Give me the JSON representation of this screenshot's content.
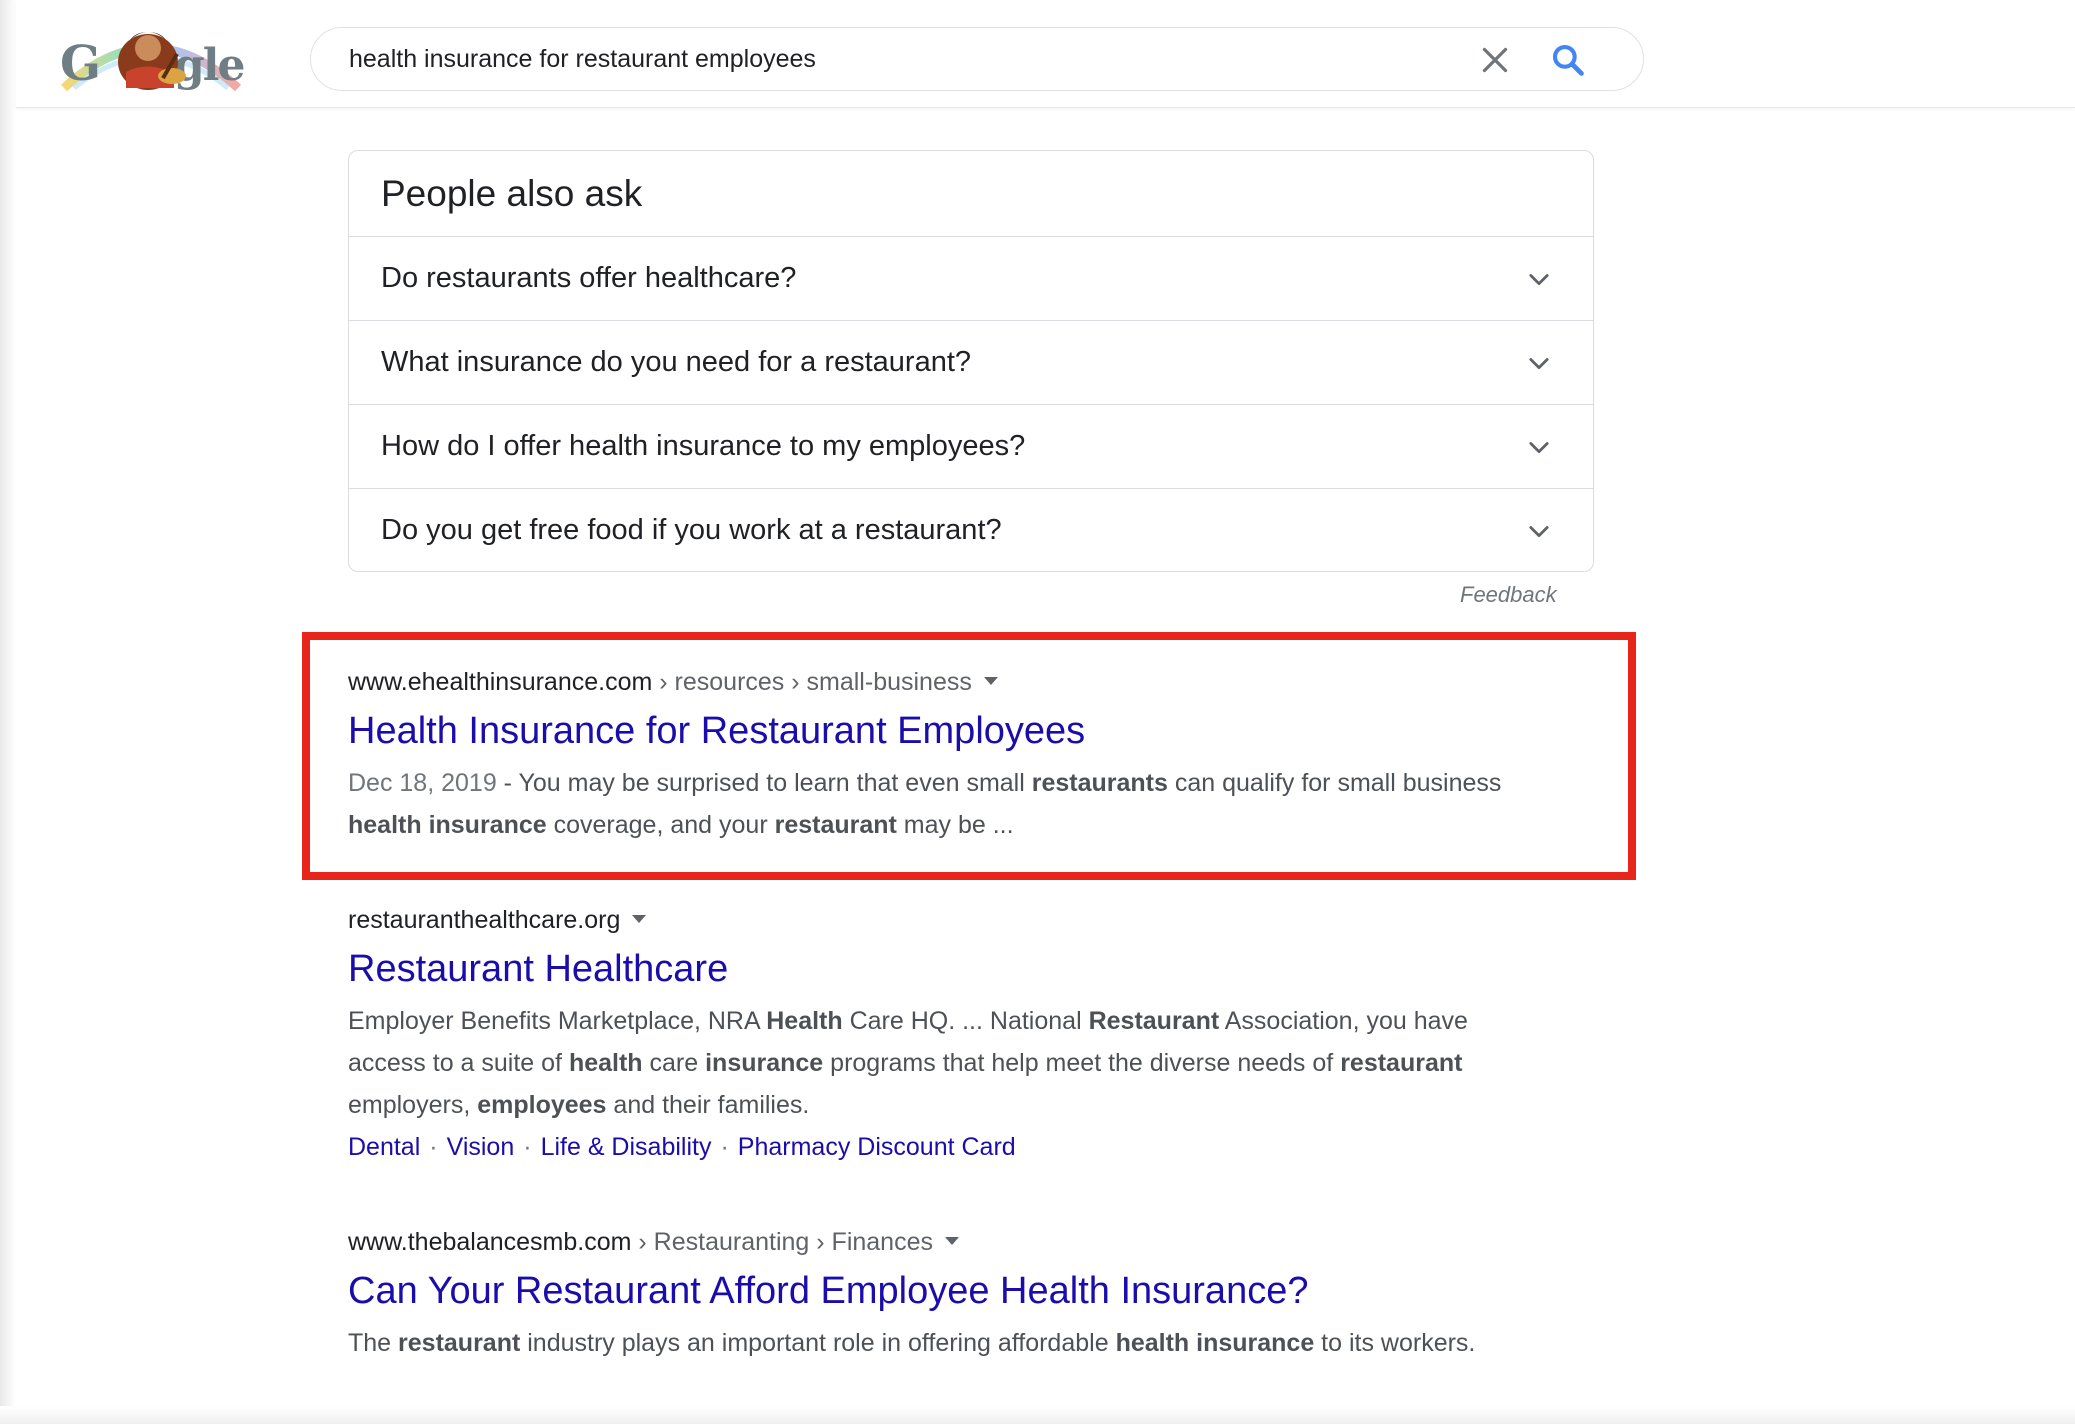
{
  "search": {
    "query": "health insurance for restaurant employees",
    "clear_icon": "close-icon",
    "search_icon": "magnifier-icon"
  },
  "logo": {
    "text": "Google"
  },
  "people_also_ask": {
    "title": "People also ask",
    "questions": [
      "Do restaurants offer healthcare?",
      "What insurance do you need for a restaurant?",
      "How do I offer health insurance to my employees?",
      "Do you get free food if you work at a restaurant?"
    ],
    "feedback": "Feedback"
  },
  "results": [
    {
      "domain": "www.ehealthinsurance.com",
      "breadcrumb": " › resources › small-business",
      "title": "Health Insurance for Restaurant Employees",
      "date": "Dec 18, 2019",
      "snippet_parts": [
        {
          "t": " - You may be surprised to learn that even small ",
          "b": false
        },
        {
          "t": "restaurants",
          "b": true
        },
        {
          "t": " can qualify for small business ",
          "b": false
        },
        {
          "t": "health insurance",
          "b": true
        },
        {
          "t": " coverage, and your ",
          "b": false
        },
        {
          "t": "restaurant",
          "b": true
        },
        {
          "t": " may be ...",
          "b": false
        }
      ]
    },
    {
      "domain": "restauranthealthcare.org",
      "breadcrumb": "",
      "title": "Restaurant Healthcare",
      "snippet_parts": [
        {
          "t": "Employer Benefits Marketplace, NRA ",
          "b": false
        },
        {
          "t": "Health",
          "b": true
        },
        {
          "t": " Care HQ. ... National ",
          "b": false
        },
        {
          "t": "Restaurant",
          "b": true
        },
        {
          "t": " Association, you have access to a suite of ",
          "b": false
        },
        {
          "t": "health",
          "b": true
        },
        {
          "t": " care ",
          "b": false
        },
        {
          "t": "insurance",
          "b": true
        },
        {
          "t": " programs that help meet the diverse needs of ",
          "b": false
        },
        {
          "t": "restaurant",
          "b": true
        },
        {
          "t": " employers, ",
          "b": false
        },
        {
          "t": "employees",
          "b": true
        },
        {
          "t": " and their families.",
          "b": false
        }
      ],
      "sitelinks": [
        "Dental",
        "Vision",
        "Life & Disability",
        "Pharmacy Discount Card"
      ]
    },
    {
      "domain": "www.thebalancesmb.com",
      "breadcrumb": " › Restauranting › Finances",
      "title": "Can Your Restaurant Afford Employee Health Insurance?",
      "snippet_parts": [
        {
          "t": "The ",
          "b": false
        },
        {
          "t": "restaurant",
          "b": true
        },
        {
          "t": " industry plays an important role in offering affordable ",
          "b": false
        },
        {
          "t": "health insurance",
          "b": true
        },
        {
          "t": " to its workers.",
          "b": false
        }
      ]
    }
  ],
  "colors": {
    "link": "#1a0dab",
    "highlight_border": "#e8251a",
    "search_icon": "#4285f4"
  }
}
